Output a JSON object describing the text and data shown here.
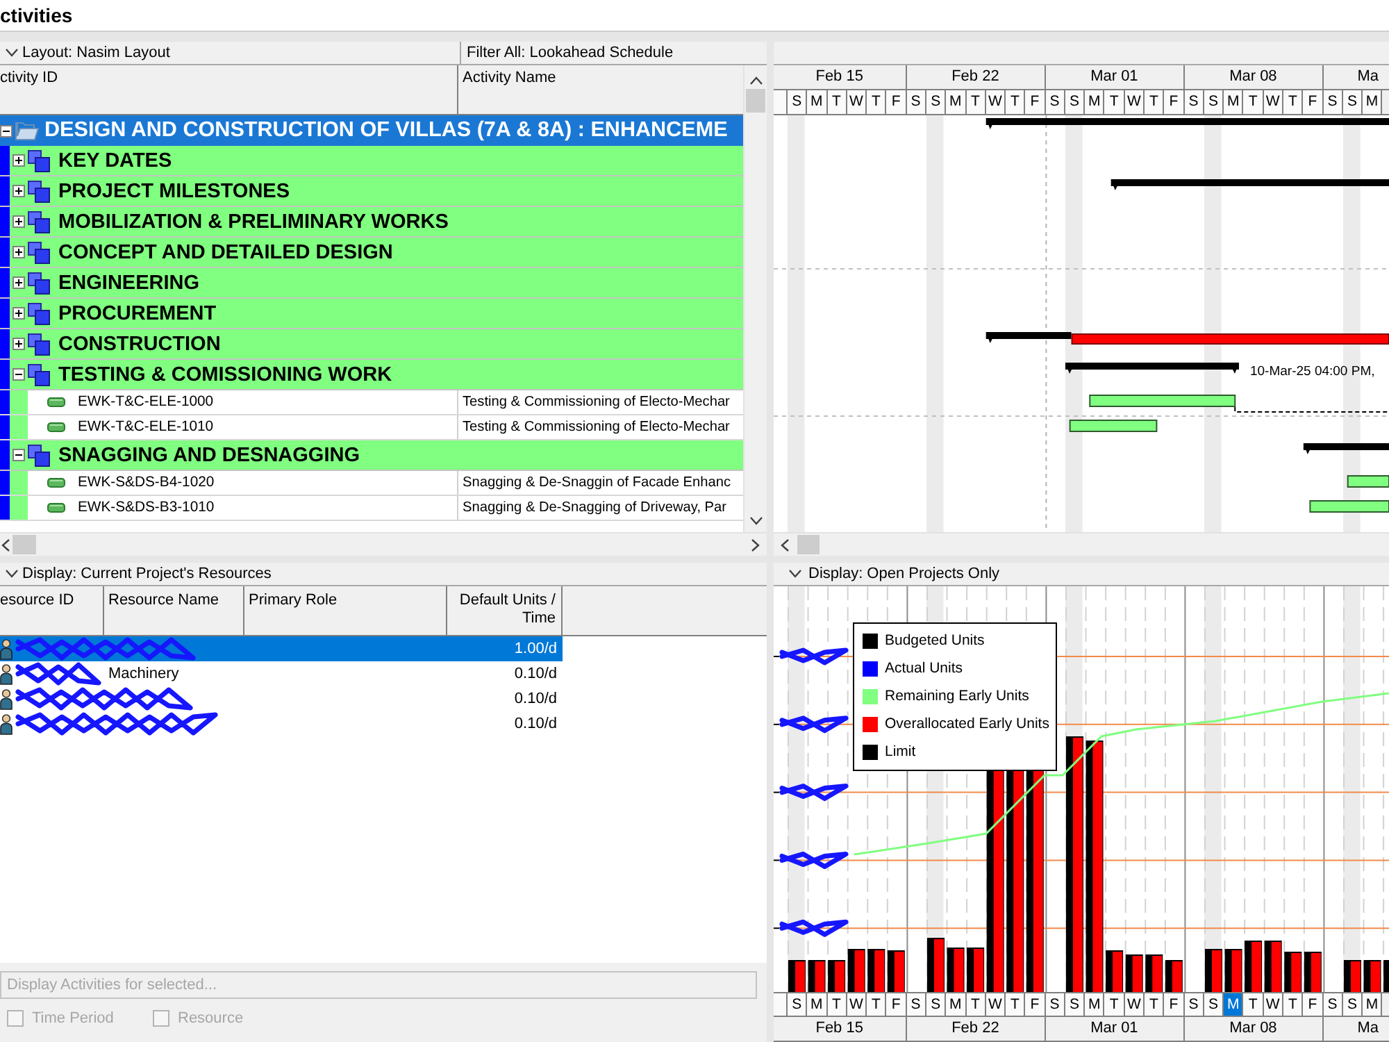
{
  "window": {
    "title": "ctivities"
  },
  "activities": {
    "layout": "Layout: Nasim Layout",
    "filter": "Filter All: Lookahead Schedule",
    "columns": [
      "ctivity ID",
      "Activity Name"
    ],
    "project": {
      "name": "DESIGN AND CONSTRUCTION OF VILLAS (7A & 8A) : ENHANCEME",
      "selected": true,
      "expanded": true,
      "children": [
        {
          "name": "KEY DATES",
          "selected": false,
          "expanded": false
        },
        {
          "name": "PROJECT MILESTONES",
          "selected": false,
          "expanded": false
        },
        {
          "name": "MOBILIZATION & PRELIMINARY WORKS",
          "selected": false,
          "expanded": false
        },
        {
          "name": "CONCEPT AND DETAILED DESIGN",
          "selected": false,
          "expanded": false
        },
        {
          "name": "ENGINEERING",
          "selected": false,
          "expanded": false
        },
        {
          "name": "PROCUREMENT",
          "selected": false,
          "expanded": false
        },
        {
          "name": "CONSTRUCTION",
          "selected": false,
          "expanded": false
        },
        {
          "name": "TESTING & COMISSIONING WORK",
          "selected": false,
          "expanded": true,
          "bar_label": "10-Mar-25 04:00 PM,",
          "children": [
            {
              "id": "EWK-T&C-ELE-1000",
              "name": "Testing & Commissioning of Electo-Mechar",
              "selected": false
            },
            {
              "id": "EWK-T&C-ELE-1010",
              "name": "Testing & Commissioning of Electo-Mechar",
              "selected": false
            }
          ]
        },
        {
          "name": "SNAGGING AND DESNAGGING",
          "selected": false,
          "expanded": true,
          "children": [
            {
              "id": "EWK-S&DS-B4-1020",
              "name": "Snagging & De-Snaggin of Facade Enhanc",
              "selected": false
            },
            {
              "id": "EWK-S&DS-B3-1010",
              "name": "Snagging & De-Snagging of Driveway, Par",
              "selected": false
            }
          ]
        }
      ]
    }
  },
  "gantt": {
    "timescale": {
      "weeks": [
        {
          "label": "Feb 15",
          "days": [
            "S",
            "M",
            "T",
            "W",
            "T",
            "F"
          ]
        },
        {
          "label": "Feb 22",
          "days": [
            "S",
            "S",
            "M",
            "T",
            "W",
            "T",
            "F"
          ]
        },
        {
          "label": "Mar 01",
          "days": [
            "S",
            "S",
            "M",
            "T",
            "W",
            "T",
            "F"
          ]
        },
        {
          "label": "Mar 08",
          "days": [
            "S",
            "S",
            "M",
            "T",
            "W",
            "T",
            "F"
          ]
        },
        {
          "label": "Ma",
          "days": [
            "S",
            "S",
            "M"
          ]
        }
      ]
    }
  },
  "resources": {
    "display": "Display: Current Project's Resources",
    "columns": [
      "esource ID",
      "Resource Name",
      "Primary Role",
      "Default Units / Time"
    ],
    "rows": [
      {
        "selected": true,
        "units": "1.00/d"
      },
      {
        "selected": false,
        "name": "Machinery",
        "units": "0.10/d"
      },
      {
        "selected": false,
        "units": "0.10/d"
      },
      {
        "selected": false,
        "units": "0.10/d"
      }
    ],
    "display_button": {
      "label": "Display Activities for selected...",
      "disabled": true
    },
    "options": [
      {
        "label": "Time Period",
        "checked": false,
        "disabled": true
      },
      {
        "label": "Resource",
        "checked": false,
        "disabled": true
      }
    ]
  },
  "histogram": {
    "display": "Display: Open Projects Only",
    "legend": [
      {
        "label": "Budgeted Units",
        "color": "#000000"
      },
      {
        "label": "Actual Units",
        "color": "#0000ff"
      },
      {
        "label": "Remaining Early Units",
        "color": "#80ff80"
      },
      {
        "label": "Overallocated Early Units",
        "color": "#ff0000"
      },
      {
        "label": "Limit",
        "color": "#000000"
      }
    ],
    "timescale": {
      "weeks": [
        {
          "label": "Feb 15",
          "days": [
            {
              "label": "S",
              "selected": false
            },
            {
              "label": "M",
              "selected": false
            },
            {
              "label": "T",
              "selected": false
            },
            {
              "label": "W",
              "selected": false
            },
            {
              "label": "T",
              "selected": false
            },
            {
              "label": "F",
              "selected": false
            }
          ]
        },
        {
          "label": "Feb 22",
          "days": [
            {
              "label": "S",
              "selected": false
            },
            {
              "label": "S",
              "selected": false
            },
            {
              "label": "M",
              "selected": false
            },
            {
              "label": "T",
              "selected": false
            },
            {
              "label": "W",
              "selected": false
            },
            {
              "label": "T",
              "selected": false
            },
            {
              "label": "F",
              "selected": false
            }
          ]
        },
        {
          "label": "Mar 01",
          "days": [
            {
              "label": "S",
              "selected": false
            },
            {
              "label": "S",
              "selected": false
            },
            {
              "label": "M",
              "selected": false
            },
            {
              "label": "T",
              "selected": false
            },
            {
              "label": "W",
              "selected": false
            },
            {
              "label": "T",
              "selected": false
            },
            {
              "label": "F",
              "selected": false
            }
          ]
        },
        {
          "label": "Mar 08",
          "days": [
            {
              "label": "S",
              "selected": false
            },
            {
              "label": "S",
              "selected": false
            },
            {
              "label": "M",
              "selected": true
            },
            {
              "label": "T",
              "selected": false
            },
            {
              "label": "W",
              "selected": false
            },
            {
              "label": "T",
              "selected": false
            },
            {
              "label": "F",
              "selected": false
            }
          ]
        },
        {
          "label": "Ma",
          "days": [
            {
              "label": "S",
              "selected": false
            },
            {
              "label": "S",
              "selected": false
            },
            {
              "label": "M",
              "selected": false
            }
          ]
        }
      ]
    }
  }
}
